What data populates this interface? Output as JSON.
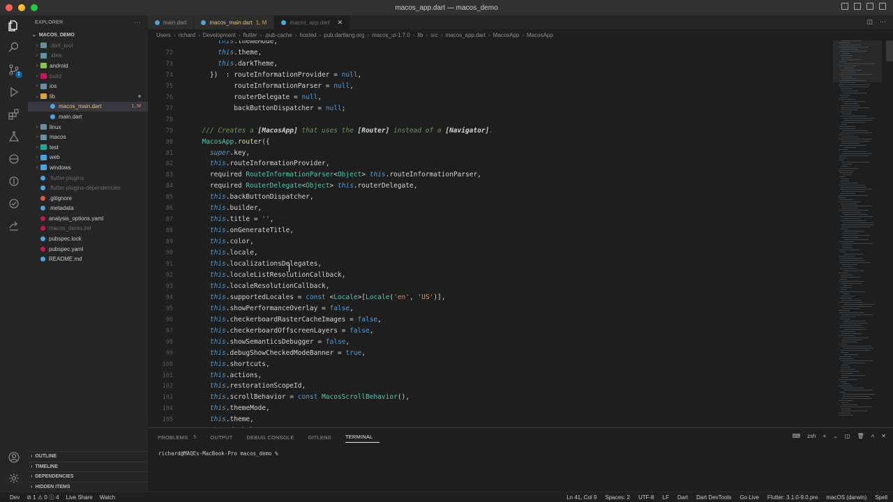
{
  "window": {
    "title": "macos_app.dart — macos_demo"
  },
  "colors": {
    "keyword_this": "#569cd6",
    "keyword_purple": "#c586c0",
    "type": "#4ec9b0",
    "string": "#ce9178",
    "comment": "#6a9955",
    "method": "#dcdcaa",
    "property": "#9cdcfe",
    "text": "#d4d4d4",
    "doc_ref": "#d4d4d4",
    "constant": "#569cd6",
    "accent": "#0e639c"
  },
  "explorer": {
    "header": "EXPLORER",
    "root": "MACOS_DEMO",
    "items": [
      {
        "label": ".dart_tool",
        "type": "folder",
        "icon_color": "#6b8e9e",
        "dim": true
      },
      {
        "label": ".idea",
        "type": "folder",
        "icon_color": "#6b8e9e",
        "dim": true
      },
      {
        "label": "android",
        "type": "folder",
        "icon_color": "#8bc34a"
      },
      {
        "label": "build",
        "type": "folder",
        "icon_color": "#c2185b",
        "dim": true
      },
      {
        "label": "ios",
        "type": "folder",
        "icon_color": "#6b8e9e"
      },
      {
        "label": "lib",
        "type": "folder-open",
        "icon_color": "#d4a34a",
        "badge_dot": true,
        "mod": true
      },
      {
        "label": "macos_main.dart",
        "type": "file",
        "icon_color": "#4fa3d9",
        "badge": "1, M",
        "selected": true,
        "mod": true
      },
      {
        "label": "main.dart",
        "type": "file",
        "icon_color": "#4fa3d9"
      },
      {
        "label": "linux",
        "type": "folder",
        "icon_color": "#6b8e9e"
      },
      {
        "label": "macos",
        "type": "folder",
        "icon_color": "#6b8e9e"
      },
      {
        "label": "test",
        "type": "folder",
        "icon_color": "#26a69a"
      },
      {
        "label": "web",
        "type": "folder",
        "icon_color": "#4fa3d9"
      },
      {
        "label": "windows",
        "type": "folder",
        "icon_color": "#4fa3d9"
      },
      {
        "label": ".flutter-plugins",
        "type": "file",
        "icon_color": "#4fa3d9",
        "dim": true
      },
      {
        "label": ".flutter-plugins-dependencies",
        "type": "file",
        "icon_color": "#4fa3d9",
        "dim": true
      },
      {
        "label": ".gitignore",
        "type": "file",
        "icon_color": "#e05d44"
      },
      {
        "label": ".metadata",
        "type": "file",
        "icon_color": "#4fa3d9"
      },
      {
        "label": "analysis_options.yaml",
        "type": "file",
        "icon_color": "#c2185b"
      },
      {
        "label": "macos_demo.iml",
        "type": "file",
        "icon_color": "#c2185b",
        "dim": true
      },
      {
        "label": "pubspec.lock",
        "type": "file",
        "icon_color": "#4fa3d9"
      },
      {
        "label": "pubspec.yaml",
        "type": "file",
        "icon_color": "#c2185b"
      },
      {
        "label": "README.md",
        "type": "file",
        "icon_color": "#4fa3d9",
        "info": true
      }
    ],
    "sections": [
      "OUTLINE",
      "TIMELINE",
      "DEPENDENCIES",
      "HIDDEN ITEMS"
    ]
  },
  "tabs": [
    {
      "label": "main.dart",
      "active": false
    },
    {
      "label": "macos_main.dart",
      "suffix": "1, M",
      "active": false,
      "modified": true
    },
    {
      "label": "macos_app.dart",
      "active": true
    }
  ],
  "breadcrumb": [
    "Users",
    "richard",
    "Development",
    "flutter",
    ".pub-cache",
    "hosted",
    "pub.dartlang.org",
    "macos_ui-1.7.0",
    "lib",
    "src",
    "macos_app.dart",
    "MacosApp",
    "MacosApp"
  ],
  "code_lines": [
    {
      "n": "",
      "tokens": [
        [
          "      ",
          "t"
        ],
        [
          "this",
          "k"
        ],
        [
          ".themeMode,",
          "t"
        ]
      ]
    },
    {
      "n": "72",
      "tokens": [
        [
          "      ",
          "t"
        ],
        [
          "this",
          "k"
        ],
        [
          ".theme,",
          "t"
        ]
      ]
    },
    {
      "n": "73",
      "tokens": [
        [
          "      ",
          "t"
        ],
        [
          "this",
          "k"
        ],
        [
          ".darkTheme,",
          "t"
        ]
      ]
    },
    {
      "n": "74",
      "tokens": [
        [
          "    })  : ",
          "t"
        ],
        [
          "routeInformationProvider",
          "t"
        ],
        [
          " = ",
          "t"
        ],
        [
          "null",
          "c"
        ],
        [
          ",",
          "t"
        ]
      ]
    },
    {
      "n": "75",
      "tokens": [
        [
          "          routeInformationParser = ",
          "t"
        ],
        [
          "null",
          "c"
        ],
        [
          ",",
          "t"
        ]
      ]
    },
    {
      "n": "76",
      "tokens": [
        [
          "          routerDelegate = ",
          "t"
        ],
        [
          "null",
          "c"
        ],
        [
          ",",
          "t"
        ]
      ]
    },
    {
      "n": "77",
      "tokens": [
        [
          "          backButtonDispatcher = ",
          "t"
        ],
        [
          "null",
          "c"
        ],
        [
          ";",
          "t"
        ]
      ]
    },
    {
      "n": "78",
      "tokens": []
    },
    {
      "n": "79",
      "tokens": [
        [
          "  /// Creates a ",
          "cm"
        ],
        [
          "[MacosApp]",
          "dr"
        ],
        [
          " that uses the ",
          "cm"
        ],
        [
          "[Router]",
          "dr"
        ],
        [
          " instead of a ",
          "cm"
        ],
        [
          "[Navigator]",
          "dr"
        ],
        [
          ".",
          "cm"
        ]
      ]
    },
    {
      "n": "80",
      "tokens": [
        [
          "  ",
          "t"
        ],
        [
          "MacosApp",
          "ty"
        ],
        [
          ".",
          "t"
        ],
        [
          "router",
          "m"
        ],
        [
          "({",
          "t"
        ]
      ]
    },
    {
      "n": "81",
      "tokens": [
        [
          "    ",
          "t"
        ],
        [
          "super",
          "k"
        ],
        [
          ".key,",
          "t"
        ]
      ]
    },
    {
      "n": "82",
      "tokens": [
        [
          "    ",
          "t"
        ],
        [
          "this",
          "k"
        ],
        [
          ".routeInformationProvider,",
          "t"
        ]
      ]
    },
    {
      "n": "83",
      "tokens": [
        [
          "    required ",
          "t"
        ],
        [
          "RouteInformationParser",
          "ty"
        ],
        [
          "<",
          "t"
        ],
        [
          "Object",
          "ty"
        ],
        [
          "> ",
          "t"
        ],
        [
          "this",
          "k"
        ],
        [
          ".routeInformationParser,",
          "t"
        ]
      ]
    },
    {
      "n": "84",
      "tokens": [
        [
          "    required ",
          "t"
        ],
        [
          "RouterDelegate",
          "ty"
        ],
        [
          "<",
          "t"
        ],
        [
          "Object",
          "ty"
        ],
        [
          "> ",
          "t"
        ],
        [
          "this",
          "k"
        ],
        [
          ".routerDelegate,",
          "t"
        ]
      ]
    },
    {
      "n": "85",
      "tokens": [
        [
          "    ",
          "t"
        ],
        [
          "this",
          "k"
        ],
        [
          ".backButtonDispatcher,",
          "t"
        ]
      ]
    },
    {
      "n": "86",
      "tokens": [
        [
          "    ",
          "t"
        ],
        [
          "this",
          "k"
        ],
        [
          ".builder,",
          "t"
        ]
      ]
    },
    {
      "n": "87",
      "tokens": [
        [
          "    ",
          "t"
        ],
        [
          "this",
          "k"
        ],
        [
          ".title = ",
          "t"
        ],
        [
          "''",
          "s"
        ],
        [
          ",",
          "t"
        ]
      ]
    },
    {
      "n": "88",
      "tokens": [
        [
          "    ",
          "t"
        ],
        [
          "this",
          "k"
        ],
        [
          ".onGenerateTitle,",
          "t"
        ]
      ]
    },
    {
      "n": "89",
      "tokens": [
        [
          "    ",
          "t"
        ],
        [
          "this",
          "k"
        ],
        [
          ".color,",
          "t"
        ]
      ]
    },
    {
      "n": "90",
      "tokens": [
        [
          "    ",
          "t"
        ],
        [
          "this",
          "k"
        ],
        [
          ".locale,",
          "t"
        ]
      ]
    },
    {
      "n": "91",
      "tokens": [
        [
          "    ",
          "t"
        ],
        [
          "this",
          "k"
        ],
        [
          ".localizationsDelegates,",
          "t"
        ]
      ]
    },
    {
      "n": "92",
      "tokens": [
        [
          "    ",
          "t"
        ],
        [
          "this",
          "k"
        ],
        [
          ".localeListResolutionCallback,",
          "t"
        ]
      ]
    },
    {
      "n": "93",
      "tokens": [
        [
          "    ",
          "t"
        ],
        [
          "this",
          "k"
        ],
        [
          ".localeResolutionCallback,",
          "t"
        ]
      ]
    },
    {
      "n": "94",
      "tokens": [
        [
          "    ",
          "t"
        ],
        [
          "this",
          "k"
        ],
        [
          ".supportedLocales = ",
          "t"
        ],
        [
          "const",
          "c"
        ],
        [
          " <",
          "t"
        ],
        [
          "Locale",
          "ty"
        ],
        [
          ">[",
          "t"
        ],
        [
          "Locale",
          "ty"
        ],
        [
          "(",
          "t"
        ],
        [
          "'en'",
          "s"
        ],
        [
          ", ",
          "t"
        ],
        [
          "'US'",
          "s"
        ],
        [
          ")],",
          "t"
        ]
      ]
    },
    {
      "n": "95",
      "tokens": [
        [
          "    ",
          "t"
        ],
        [
          "this",
          "k"
        ],
        [
          ".showPerformanceOverlay = ",
          "t"
        ],
        [
          "false",
          "c"
        ],
        [
          ",",
          "t"
        ]
      ]
    },
    {
      "n": "96",
      "tokens": [
        [
          "    ",
          "t"
        ],
        [
          "this",
          "k"
        ],
        [
          ".checkerboardRasterCacheImages = ",
          "t"
        ],
        [
          "false",
          "c"
        ],
        [
          ",",
          "t"
        ]
      ]
    },
    {
      "n": "97",
      "tokens": [
        [
          "    ",
          "t"
        ],
        [
          "this",
          "k"
        ],
        [
          ".checkerboardOffscreenLayers = ",
          "t"
        ],
        [
          "false",
          "c"
        ],
        [
          ",",
          "t"
        ]
      ]
    },
    {
      "n": "98",
      "tokens": [
        [
          "    ",
          "t"
        ],
        [
          "this",
          "k"
        ],
        [
          ".showSemanticsDebugger = ",
          "t"
        ],
        [
          "false",
          "c"
        ],
        [
          ",",
          "t"
        ]
      ]
    },
    {
      "n": "99",
      "tokens": [
        [
          "    ",
          "t"
        ],
        [
          "this",
          "k"
        ],
        [
          ".debugShowCheckedModeBanner = ",
          "t"
        ],
        [
          "true",
          "c"
        ],
        [
          ",",
          "t"
        ]
      ]
    },
    {
      "n": "100",
      "tokens": [
        [
          "    ",
          "t"
        ],
        [
          "this",
          "k"
        ],
        [
          ".shortcuts,",
          "t"
        ]
      ]
    },
    {
      "n": "101",
      "tokens": [
        [
          "    ",
          "t"
        ],
        [
          "this",
          "k"
        ],
        [
          ".actions,",
          "t"
        ]
      ]
    },
    {
      "n": "102",
      "tokens": [
        [
          "    ",
          "t"
        ],
        [
          "this",
          "k"
        ],
        [
          ".restorationScopeId,",
          "t"
        ]
      ]
    },
    {
      "n": "103",
      "tokens": [
        [
          "    ",
          "t"
        ],
        [
          "this",
          "k"
        ],
        [
          ".scrollBehavior = ",
          "t"
        ],
        [
          "const",
          "c"
        ],
        [
          " ",
          "t"
        ],
        [
          "MacosScrollBehavior",
          "ty"
        ],
        [
          "(),",
          "t"
        ]
      ]
    },
    {
      "n": "104",
      "tokens": [
        [
          "    ",
          "t"
        ],
        [
          "this",
          "k"
        ],
        [
          ".themeMode,",
          "t"
        ]
      ]
    },
    {
      "n": "105",
      "tokens": [
        [
          "    ",
          "t"
        ],
        [
          "this",
          "k"
        ],
        [
          ".theme,",
          "t"
        ]
      ]
    },
    {
      "n": "",
      "tokens": [
        [
          "    ",
          "t"
        ],
        [
          "this",
          "k"
        ],
        [
          ".darkTheme,",
          "t"
        ]
      ]
    }
  ],
  "panel": {
    "tabs": [
      {
        "label": "PROBLEMS",
        "count": "5"
      },
      {
        "label": "OUTPUT"
      },
      {
        "label": "DEBUG CONSOLE"
      },
      {
        "label": "GITLENS"
      },
      {
        "label": "TERMINAL",
        "active": true
      }
    ],
    "shell": "zsh",
    "terminal_prompt": "richard@MAQEs-MacBook-Pro macos_demo %"
  },
  "statusbar": {
    "left": [
      "Dev",
      "⊘ 1  ⚠ 0  ⓘ 4",
      "Live Share",
      "Watch"
    ],
    "right": [
      "Ln 41, Col 9",
      "Spaces: 2",
      "UTF-8",
      "LF",
      "Dart",
      "Dart DevTools",
      "Go Live",
      "Flutter: 3.1.0-9.0.pre",
      "macOS (darwin)",
      "Spell"
    ]
  }
}
